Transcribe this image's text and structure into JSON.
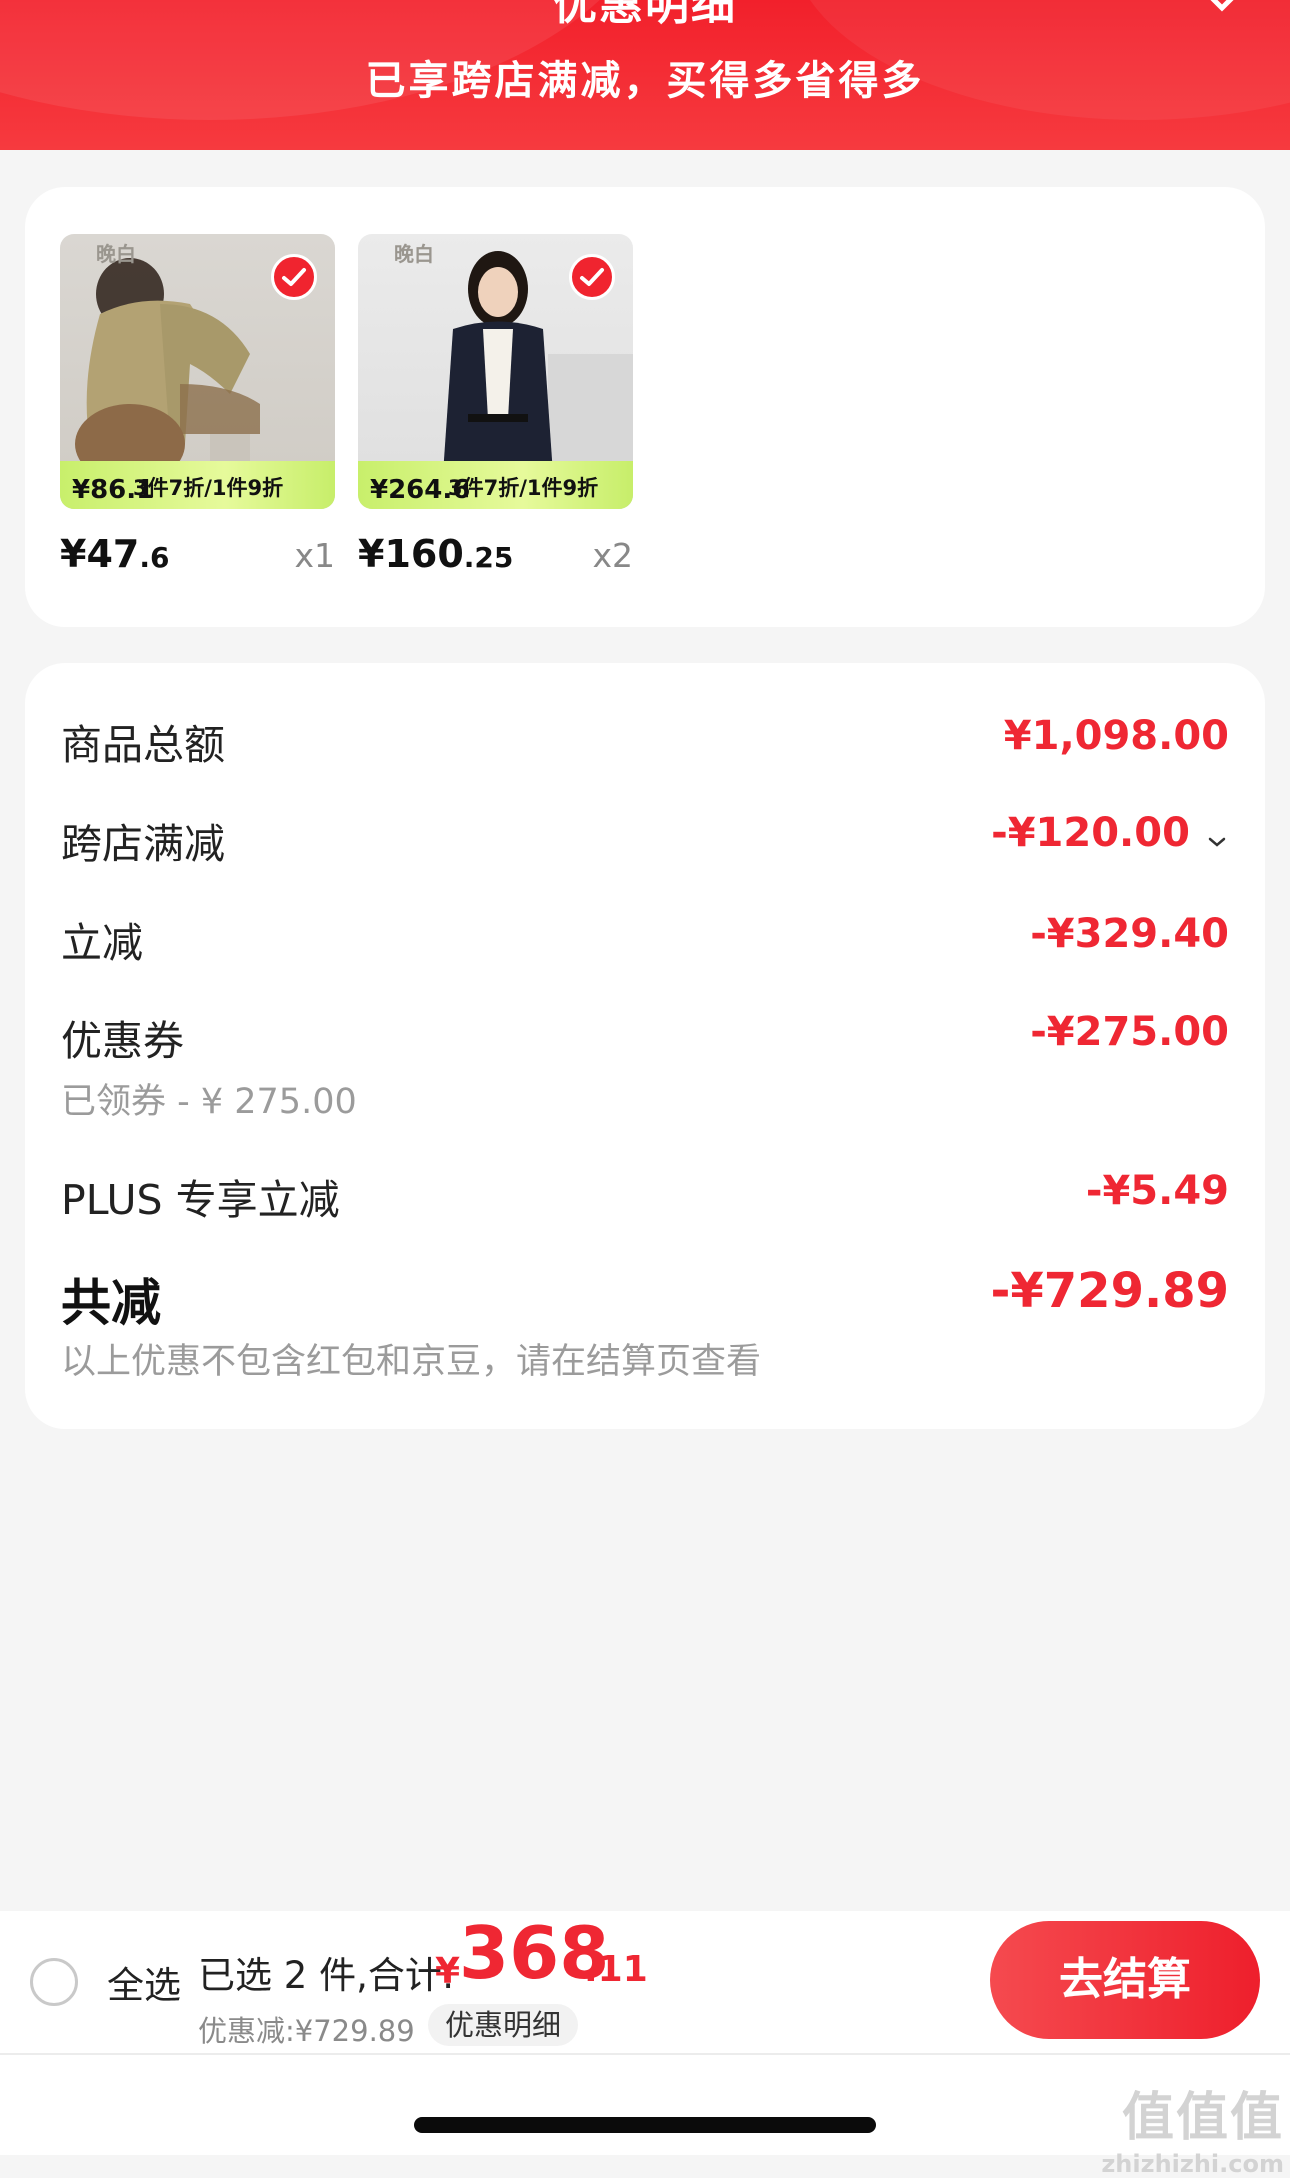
{
  "header": {
    "title": "优惠明细",
    "subtitle": "已享跨店满减，买得多省得多",
    "close_icon": "close-icon"
  },
  "products": [
    {
      "brand": "晚白",
      "price_int": "¥47",
      "price_dec": ".6",
      "qty": "x1",
      "promo_price": "¥86.1",
      "promo_text": "3件7折/1件9折",
      "selected": true
    },
    {
      "brand": "晚白",
      "price_int": "¥160",
      "price_dec": ".25",
      "qty": "x2",
      "promo_price": "¥264.6",
      "promo_text": "3件7折/1件9折",
      "selected": true
    }
  ],
  "summary": {
    "goods_total_label": "商品总额",
    "goods_total_value": "¥1,098.00",
    "cross_store_label": "跨店满减",
    "cross_store_value": "-¥120.00",
    "instant_label": "立减",
    "instant_value": "-¥329.40",
    "coupon_label": "优惠券",
    "coupon_value": "-¥275.00",
    "coupon_sub": "已领券 - ¥ 275.00",
    "plus_label": "PLUS 专享立减",
    "plus_value": "-¥5.49",
    "total_label": "共减",
    "total_value": "-¥729.89",
    "note": "以上优惠不包含红包和京豆，请在结算页查看"
  },
  "bottom_bar": {
    "select_all": "全选",
    "selected_text": "已选 2 件,合计:",
    "total_currency": "¥",
    "total_int": "368",
    "total_dec": ".11",
    "discount_text": "优惠减:¥729.89",
    "detail_label": "优惠明细",
    "checkout_label": "去结算"
  },
  "watermark": {
    "big": "值值值",
    "small": "zhizhizhi.com"
  },
  "colors": {
    "accent_red": "#ef2733",
    "header_red": "#f2202b",
    "background": "#f5f5f5"
  }
}
